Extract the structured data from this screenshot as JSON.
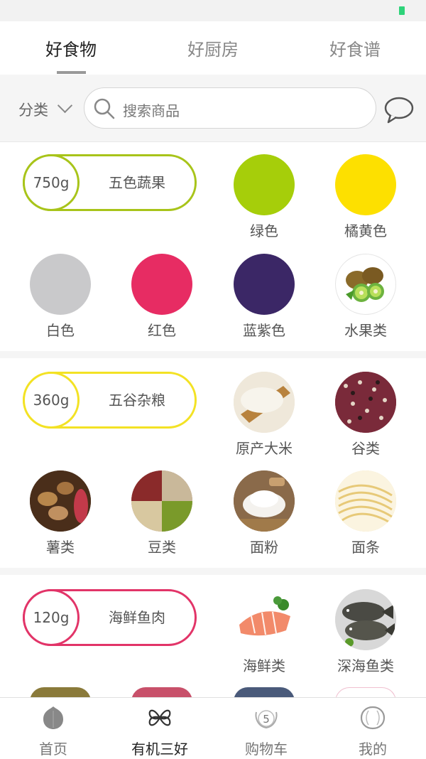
{
  "tabs": [
    {
      "label": "好食物",
      "active": true
    },
    {
      "label": "好厨房",
      "active": false
    },
    {
      "label": "好食谱",
      "active": false
    }
  ],
  "search": {
    "category_label": "分类",
    "placeholder": "搜索商品"
  },
  "sections": [
    {
      "weight": "750g",
      "title": "五色蔬果",
      "accent": "#a8c41a",
      "items": [
        {
          "label": "绿色",
          "color": "#a6ce0a"
        },
        {
          "label": "橘黄色",
          "color": "#fde000"
        },
        {
          "label": "白色",
          "color": "#c9c9cb"
        },
        {
          "label": "红色",
          "color": "#e72c63"
        },
        {
          "label": "蓝紫色",
          "color": "#3b2766"
        },
        {
          "label": "水果类",
          "icon": "kiwi-photo"
        }
      ]
    },
    {
      "weight": "360g",
      "title": "五谷杂粮",
      "accent": "#f3e224",
      "items": [
        {
          "label": "原产大米",
          "icon": "rice-photo"
        },
        {
          "label": "谷类",
          "icon": "grains-photo"
        },
        {
          "label": "薯类",
          "icon": "potato-photo"
        },
        {
          "label": "豆类",
          "icon": "beans-photo"
        },
        {
          "label": "面粉",
          "icon": "flour-photo"
        },
        {
          "label": "面条",
          "icon": "noodles-photo"
        }
      ]
    },
    {
      "weight": "120g",
      "title": "海鲜鱼肉",
      "accent": "#e23468",
      "items": [
        {
          "label": "海鲜类",
          "icon": "salmon-photo"
        },
        {
          "label": "深海鱼类",
          "icon": "fish-photo"
        }
      ]
    }
  ],
  "bottom_nav": [
    {
      "label": "首页",
      "icon": "home-icon",
      "active": false
    },
    {
      "label": "有机三好",
      "icon": "organic-icon",
      "active": true
    },
    {
      "label": "购物车",
      "icon": "cart-icon",
      "badge": "5",
      "active": false
    },
    {
      "label": "我的",
      "icon": "profile-icon",
      "active": false
    }
  ]
}
